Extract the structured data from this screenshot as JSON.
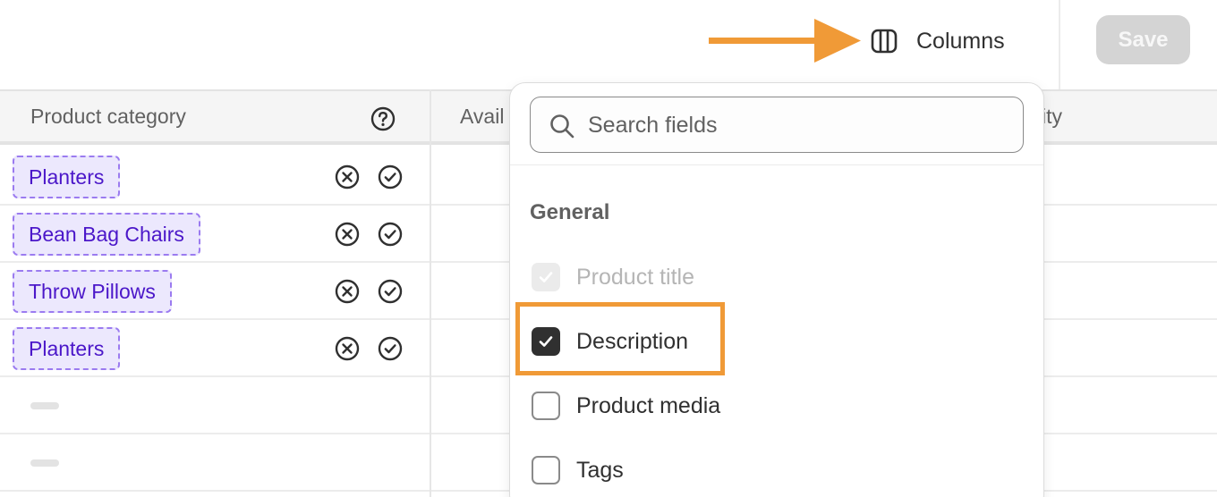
{
  "toolbar": {
    "columns_label": "Columns",
    "save_label": "Save",
    "accent_color": "#f09a37"
  },
  "table": {
    "headers": [
      "Product category",
      "Avail",
      "ity"
    ],
    "rows": [
      {
        "category": "Planters"
      },
      {
        "category": "Bean Bag Chairs"
      },
      {
        "category": "Throw Pillows"
      },
      {
        "category": "Planters"
      },
      {
        "category": ""
      },
      {
        "category": ""
      }
    ],
    "row_icons": [
      "x-circle-icon",
      "check-circle-icon"
    ],
    "header_icon": "help-circle-icon"
  },
  "columns_panel": {
    "search_placeholder": "Search fields",
    "group_title": "General",
    "options": [
      {
        "label": "Product title",
        "state": "checked-disabled"
      },
      {
        "label": "Description",
        "state": "checked"
      },
      {
        "label": "Product media",
        "state": "unchecked"
      },
      {
        "label": "Tags",
        "state": "unchecked"
      }
    ]
  }
}
